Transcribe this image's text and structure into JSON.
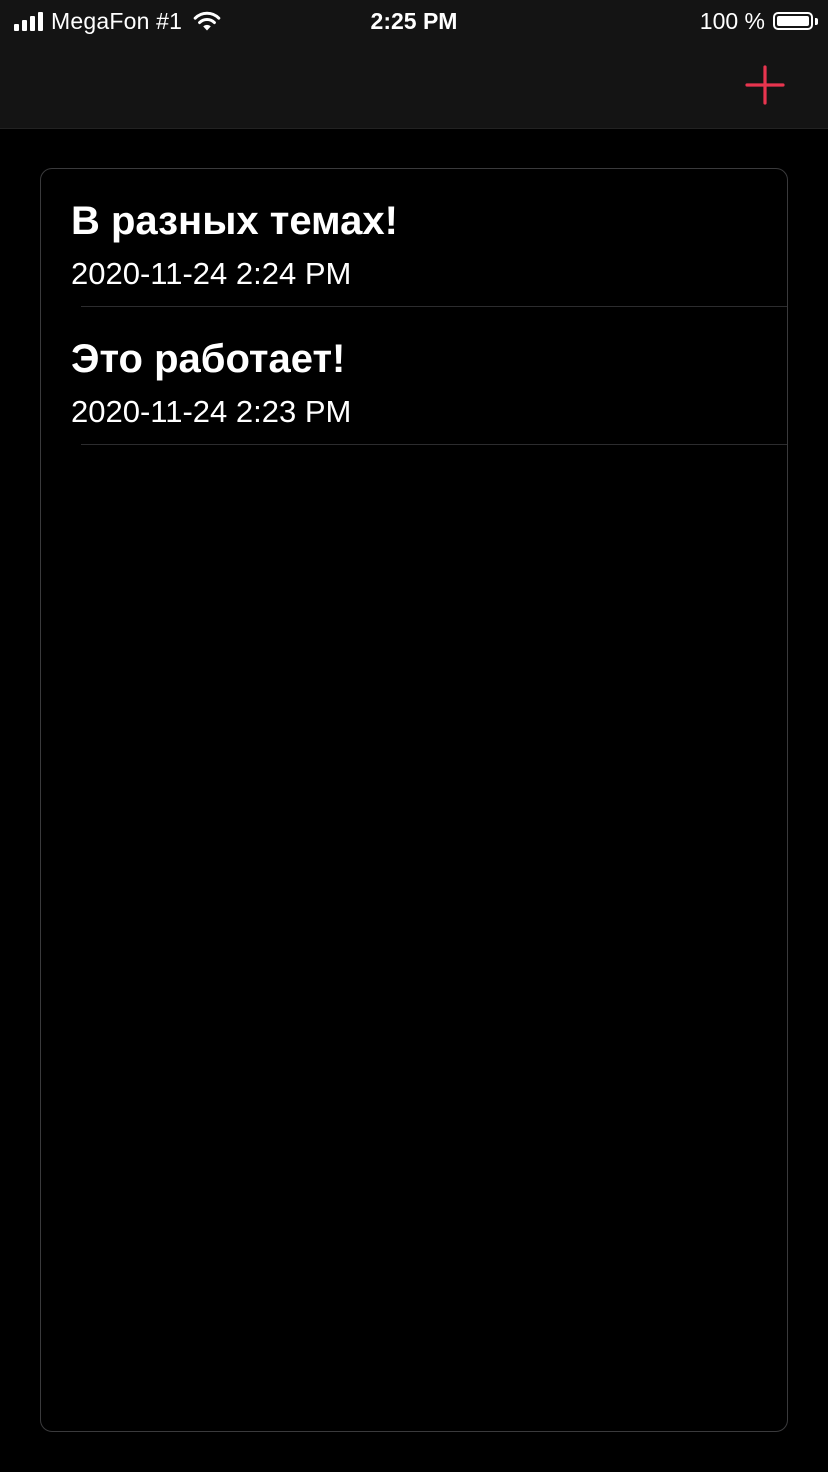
{
  "status_bar": {
    "carrier": "MegaFon #1",
    "time": "2:25 PM",
    "battery_text": "100 %",
    "icons": [
      "signal-icon",
      "wifi-icon",
      "battery-icon"
    ]
  },
  "nav": {
    "add_icon": "plus-icon",
    "accent_color": "#e8354f"
  },
  "notes": [
    {
      "title": "В разных темах!",
      "date": "2020-11-24 2:24 PM"
    },
    {
      "title": "Это работает!",
      "date": "2020-11-24 2:23 PM"
    }
  ]
}
